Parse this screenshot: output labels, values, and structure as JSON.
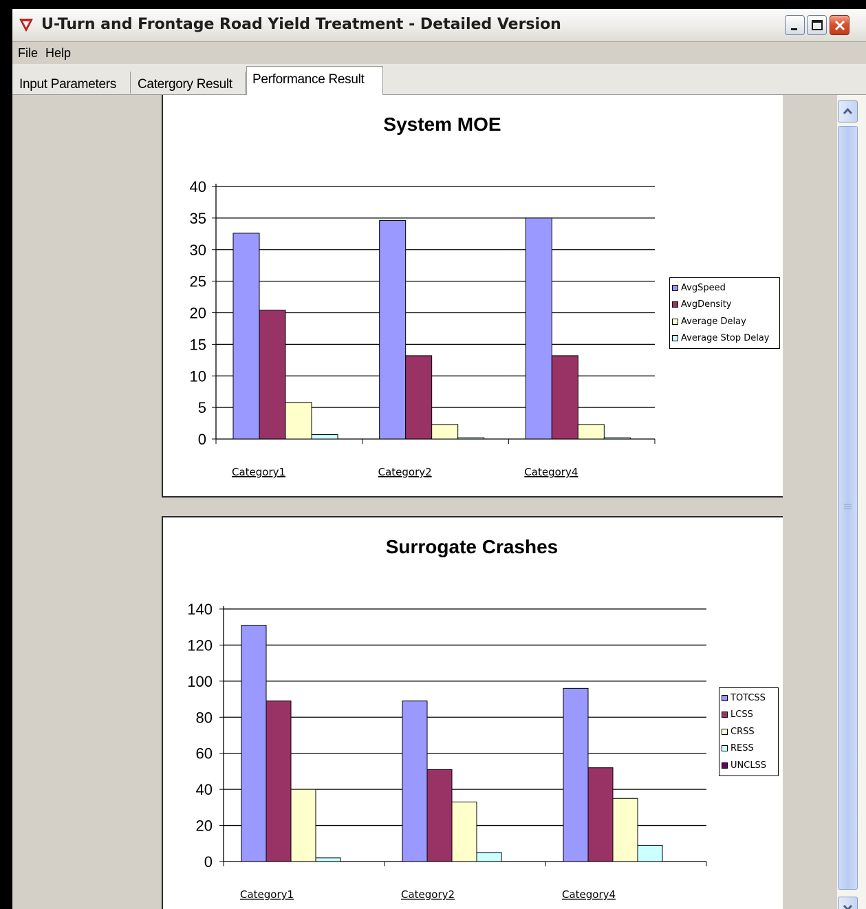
{
  "window": {
    "title": "U-Turn and Frontage Road Yield Treatment - Detailed Version"
  },
  "menu": {
    "file": "File",
    "help": "Help"
  },
  "tabs": [
    {
      "label": "Input Parameters"
    },
    {
      "label": "Catergory Result"
    },
    {
      "label": "Performance Result",
      "selected": true
    }
  ],
  "icons": {
    "app": "red-down-triangle-icon",
    "minimize": "minimize-icon",
    "maximize": "maximize-icon",
    "close": "close-icon",
    "scroll_up": "chevron-up-icon",
    "scroll_down": "chevron-down-icon"
  },
  "colors": {
    "series": [
      "#9999ff",
      "#993366",
      "#ffffcc",
      "#ccffff",
      "#660066"
    ]
  },
  "chart_data": [
    {
      "type": "bar",
      "title": "System MOE",
      "categories": [
        "Category1",
        "Category2",
        "Category4"
      ],
      "ylim": [
        0,
        40
      ],
      "yticks": [
        0,
        5,
        10,
        15,
        20,
        25,
        30,
        35,
        40
      ],
      "grid": true,
      "legend_position": "right",
      "series": [
        {
          "name": "AvgSpeed",
          "values": [
            32.6,
            34.6,
            35.0
          ],
          "color": "#9999ff"
        },
        {
          "name": "AvgDensity",
          "values": [
            20.4,
            13.2,
            13.2
          ],
          "color": "#993366"
        },
        {
          "name": "Average Delay",
          "values": [
            5.8,
            2.3,
            2.3
          ],
          "color": "#ffffcc"
        },
        {
          "name": "Average Stop Delay",
          "values": [
            0.7,
            0.2,
            0.2
          ],
          "color": "#ccffff"
        }
      ]
    },
    {
      "type": "bar",
      "title": "Surrogate Crashes",
      "categories": [
        "Category1",
        "Category2",
        "Category4"
      ],
      "ylim": [
        0,
        140
      ],
      "yticks": [
        0,
        20,
        40,
        60,
        80,
        100,
        120,
        140
      ],
      "grid": true,
      "legend_position": "right",
      "series": [
        {
          "name": "TOTCSS",
          "values": [
            131,
            89,
            96
          ],
          "color": "#9999ff"
        },
        {
          "name": "LCSS",
          "values": [
            89,
            51,
            52
          ],
          "color": "#993366"
        },
        {
          "name": "CRSS",
          "values": [
            40,
            33,
            35
          ],
          "color": "#ffffcc"
        },
        {
          "name": "RESS",
          "values": [
            2,
            5,
            9
          ],
          "color": "#ccffff"
        },
        {
          "name": "UNCLSS",
          "values": [
            0,
            0,
            0
          ],
          "color": "#660066"
        }
      ]
    }
  ]
}
